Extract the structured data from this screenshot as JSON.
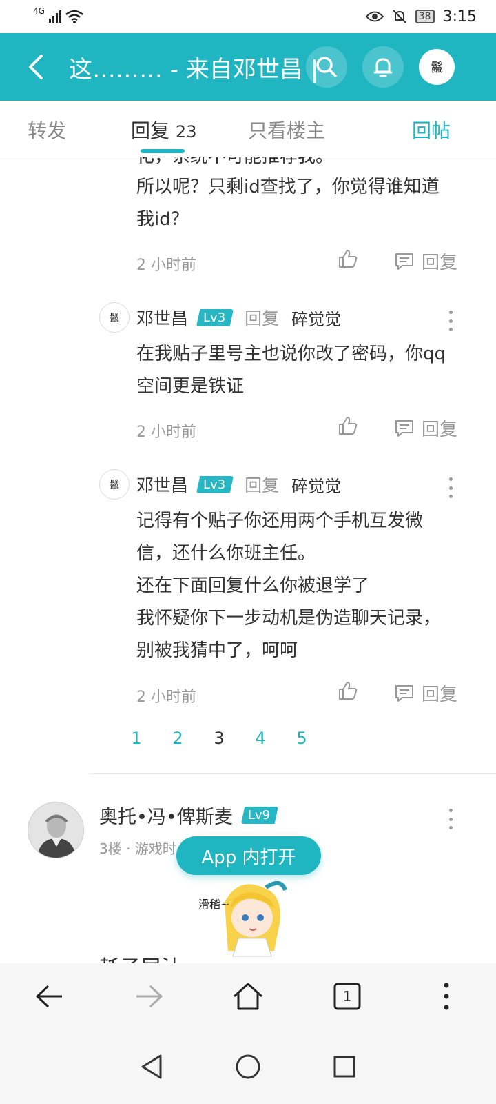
{
  "status_bar": {
    "network": "4G",
    "battery": "38",
    "time": "3:15"
  },
  "header": {
    "title": "这……… - 来自邓世昌 |…",
    "avatar_glyph": "鬣"
  },
  "tabs": {
    "forward": "转发",
    "replies": "回复",
    "replies_count": "23",
    "op_only": "只看楼主",
    "reply_post": "回帖"
  },
  "comments": {
    "partial_top": {
      "cut_line": "化，系统不可能推荐我。",
      "lines": [
        "所以呢？只剩id查找了，你觉得谁知道",
        "我id？"
      ],
      "time": "2 小时前",
      "reply_label": "回复"
    },
    "items": [
      {
        "user": "邓世昌",
        "level": "Lv3",
        "reply_word": "回复",
        "reply_to": "碎觉觉",
        "lines": [
          "在我贴子里号主也说你改了密码，你qq",
          "空间更是铁证"
        ],
        "time": "2 小时前",
        "reply_label": "回复"
      },
      {
        "user": "邓世昌",
        "level": "Lv3",
        "reply_word": "回复",
        "reply_to": "碎觉觉",
        "lines": [
          "记得有个贴子你还用两个手机互发微",
          "信，还什么你班主任。",
          "还在下面回复什么你被退学了",
          "我怀疑你下一步动机是伪造聊天记录，",
          "别被我猜中了，呵呵"
        ],
        "time": "2 小时前",
        "reply_label": "回复"
      }
    ]
  },
  "pager": {
    "pages": [
      "1",
      "2",
      "3",
      "4",
      "5"
    ],
    "current": "3"
  },
  "floor": {
    "user": "奥托•冯•俾斯麦",
    "level": "Lv9",
    "meta": "3楼 · 游戏时",
    "cut_text": "耗子尾汁"
  },
  "app_open_label": "App 内打开",
  "sticker_text": "滑稽~",
  "browser": {
    "tab_count": "1"
  },
  "colors": {
    "accent": "#1fb6c2",
    "text": "#333333",
    "muted": "#999999"
  }
}
